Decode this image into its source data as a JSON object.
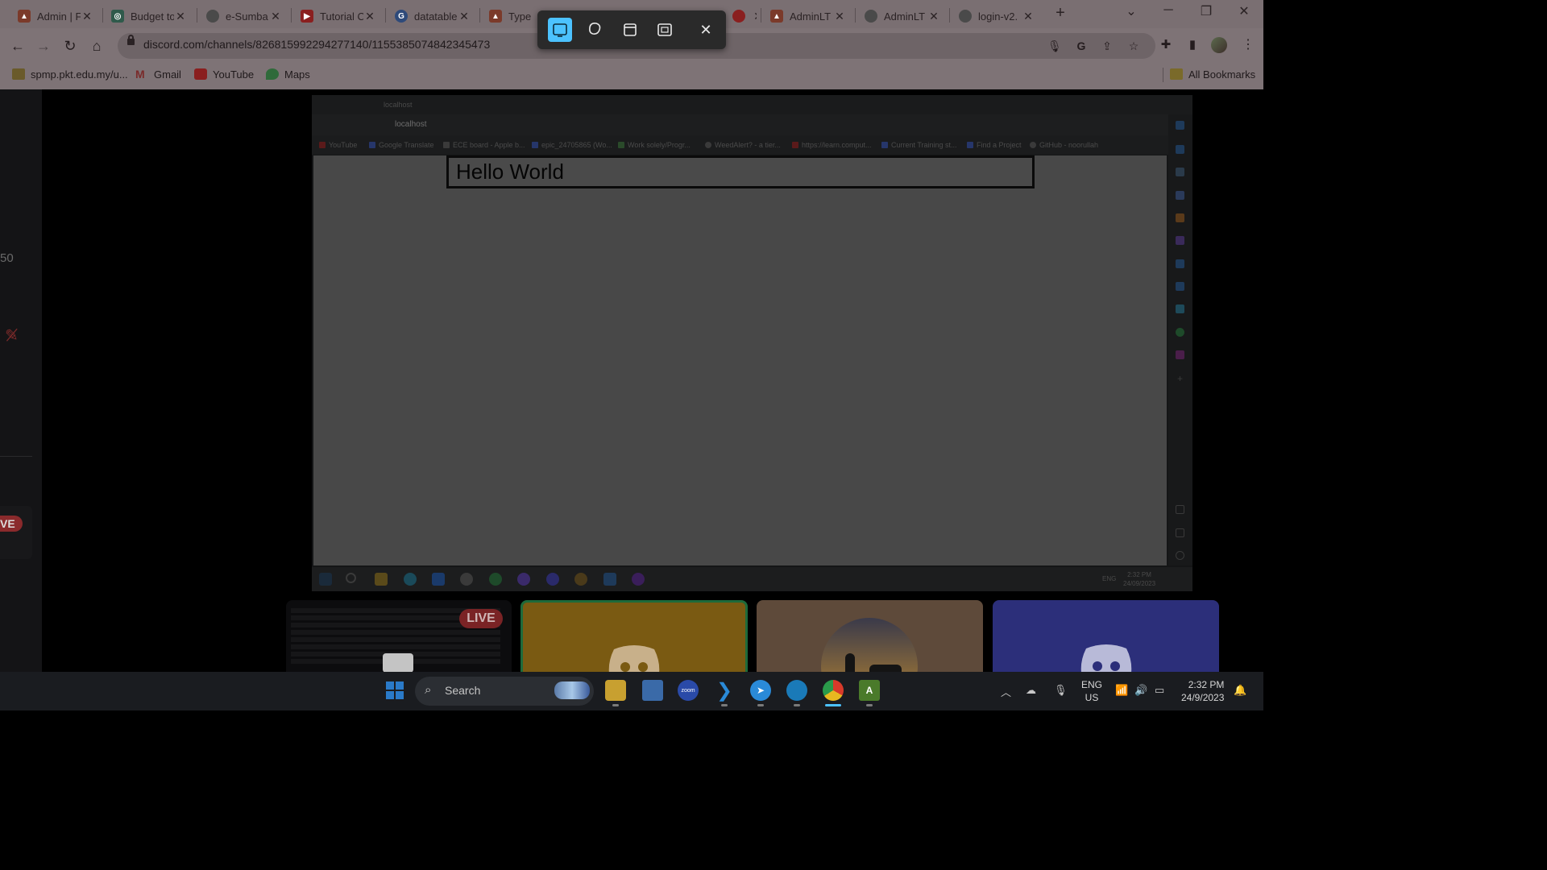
{
  "browser": {
    "tabs": [
      {
        "label": "Admin | F",
        "fav_color": "#7b3a2a"
      },
      {
        "label": "Budget to",
        "fav_color": "#2f5a4b"
      },
      {
        "label": "e-Sumba",
        "fav_color": "#4a4a4a"
      },
      {
        "label": "Tutorial C",
        "fav_color": "#8a1f1f"
      },
      {
        "label": "datatable",
        "fav_color": "#2e4a7a"
      },
      {
        "label": "TypeErr",
        "fav_color": "#7b3a2a"
      },
      {
        "label": "AdminLT",
        "fav_color": "#7b3a2a"
      },
      {
        "label": "AdminLT",
        "fav_color": "#4a4a4a"
      },
      {
        "label": "login-v2.",
        "fav_color": "#4a4a4a"
      }
    ],
    "new_tab_label": "+",
    "url": "discord.com/channels/826815992294277140/1155385074842345473",
    "bookmarks": [
      {
        "label": "spmp.pkt.edu.my/u...",
        "color": "#6a5a2a"
      },
      {
        "label": "Gmail",
        "color": "#7a2a2a"
      },
      {
        "label": "YouTube",
        "color": "#8a1f1f"
      },
      {
        "label": "Maps",
        "color": "#2f6a3a"
      }
    ],
    "all_bookmarks_label": "All Bookmarks"
  },
  "snip_toolbar": {
    "modes": [
      "rectangle-mode",
      "freeform-mode",
      "window-mode",
      "fullscreen-mode"
    ],
    "close_label": "✕"
  },
  "left_panel": {
    "count_text": "50",
    "live_badge": "VE"
  },
  "shared_screen": {
    "tab_title": "localhost",
    "url": "localhost",
    "bookmarks": [
      "YouTube",
      "Google Translate",
      "ECE board - Apple b...",
      "epic_24705865 (Wo...",
      "Work solely/Progr...",
      "WeedAlert? - a tier...",
      "https://learn.comput...",
      "Current Training st...",
      "Find a Project",
      "GitHub - noorullah"
    ],
    "page_heading": "Hello World",
    "clock_time": "2:32 PM",
    "clock_date": "24/09/2023",
    "lang": "ENG"
  },
  "participants": {
    "live_label": "LIVE",
    "tiles": [
      {
        "name": "screen-preview-tile",
        "color": "#0c0c0e"
      },
      {
        "name": "yellow-avatar-tile",
        "color": "#7a5a12"
      },
      {
        "name": "sunset-avatar-tile",
        "color": "#5e4a3a"
      },
      {
        "name": "blue-avatar-tile",
        "color": "#2c2f7a"
      }
    ]
  },
  "taskbar": {
    "search_label": "Search",
    "lang_top": "ENG",
    "lang_bottom": "US",
    "time": "2:32 PM",
    "date": "24/9/2023"
  }
}
